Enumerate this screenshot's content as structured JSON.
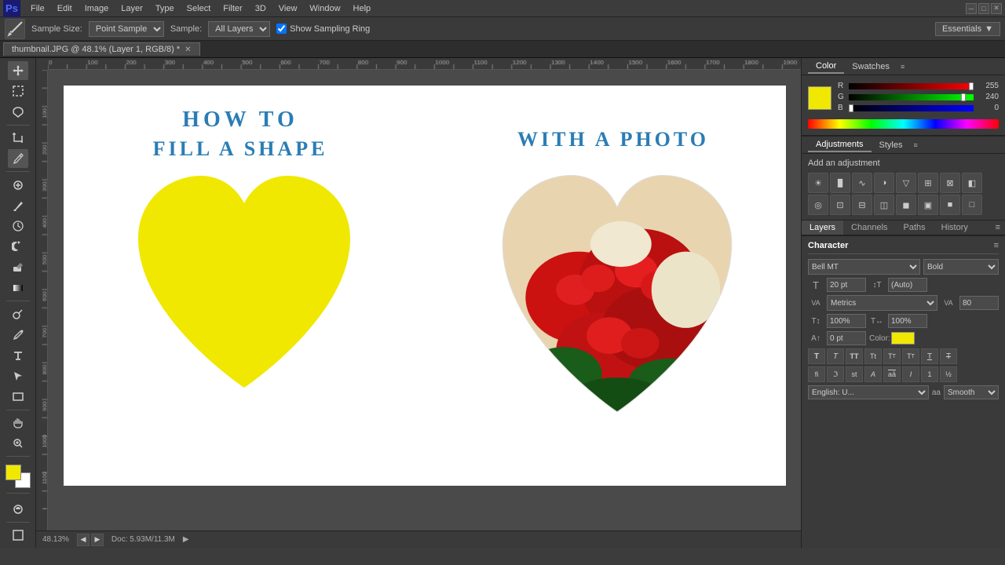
{
  "menubar": {
    "logo": "Ps",
    "items": [
      "File",
      "Edit",
      "Image",
      "Layer",
      "Type",
      "Select",
      "Filter",
      "3D",
      "View",
      "Window",
      "Help"
    ]
  },
  "toolbar_top": {
    "tool_icon": "eyedropper",
    "sample_size_label": "Sample Size:",
    "sample_size_value": "Point Sample",
    "sample_label": "Sample:",
    "sample_value": "All Layers",
    "show_sampling_ring": true,
    "show_sampling_ring_label": "Show Sampling Ring",
    "essentials": "Essentials"
  },
  "tabbar": {
    "tab_name": "thumbnail.JPG @ 48.1% (Layer 1, RGB/8) *"
  },
  "canvas": {
    "title_line1": "HOW TO",
    "title_line2": "FILL  A  SHAPE",
    "title_right": "WITH  A  PHOTO"
  },
  "statusbar": {
    "zoom": "48.13%",
    "doc_info": "Doc: 5.93M/11.3M"
  },
  "color_panel": {
    "tabs": [
      "Color",
      "Swatches"
    ],
    "r_value": "255",
    "g_value": "240",
    "b_value": "0",
    "r_pct": 100,
    "g_pct": 94,
    "b_pct": 0
  },
  "adjustments_panel": {
    "tabs": [
      "Adjustments",
      "Styles"
    ],
    "title": "Add an adjustment",
    "icons": [
      "☀",
      "◑",
      "◧",
      "◈",
      "▽",
      "⊕",
      "⊞",
      "◎",
      "⊡",
      "◉",
      "⊠",
      "◫",
      "⊟",
      "◻",
      "■",
      "□",
      "◼",
      "◻",
      "▣",
      "⊕"
    ]
  },
  "layers_panel": {
    "tabs": [
      "Layers",
      "Channels",
      "Paths",
      "History"
    ]
  },
  "character_panel": {
    "title": "Character",
    "font_family": "Bell MT",
    "font_style": "Bold",
    "font_size": "20 pt",
    "leading": "(Auto)",
    "kerning": "Metrics",
    "tracking": "80",
    "horizontal_scale": "100%",
    "vertical_scale": "100%",
    "baseline_shift": "0 pt",
    "color_label": "Color:",
    "format_buttons": [
      "T",
      "T",
      "TT",
      "Tt",
      "T̲",
      "T̳",
      "T",
      "T"
    ],
    "special_buttons": [
      "fi",
      "ℑ",
      "st",
      "A",
      "aā",
      "I",
      "1",
      "½"
    ],
    "language": "English: U...",
    "aa_option": "aa",
    "anti_alias": "Smooth"
  }
}
